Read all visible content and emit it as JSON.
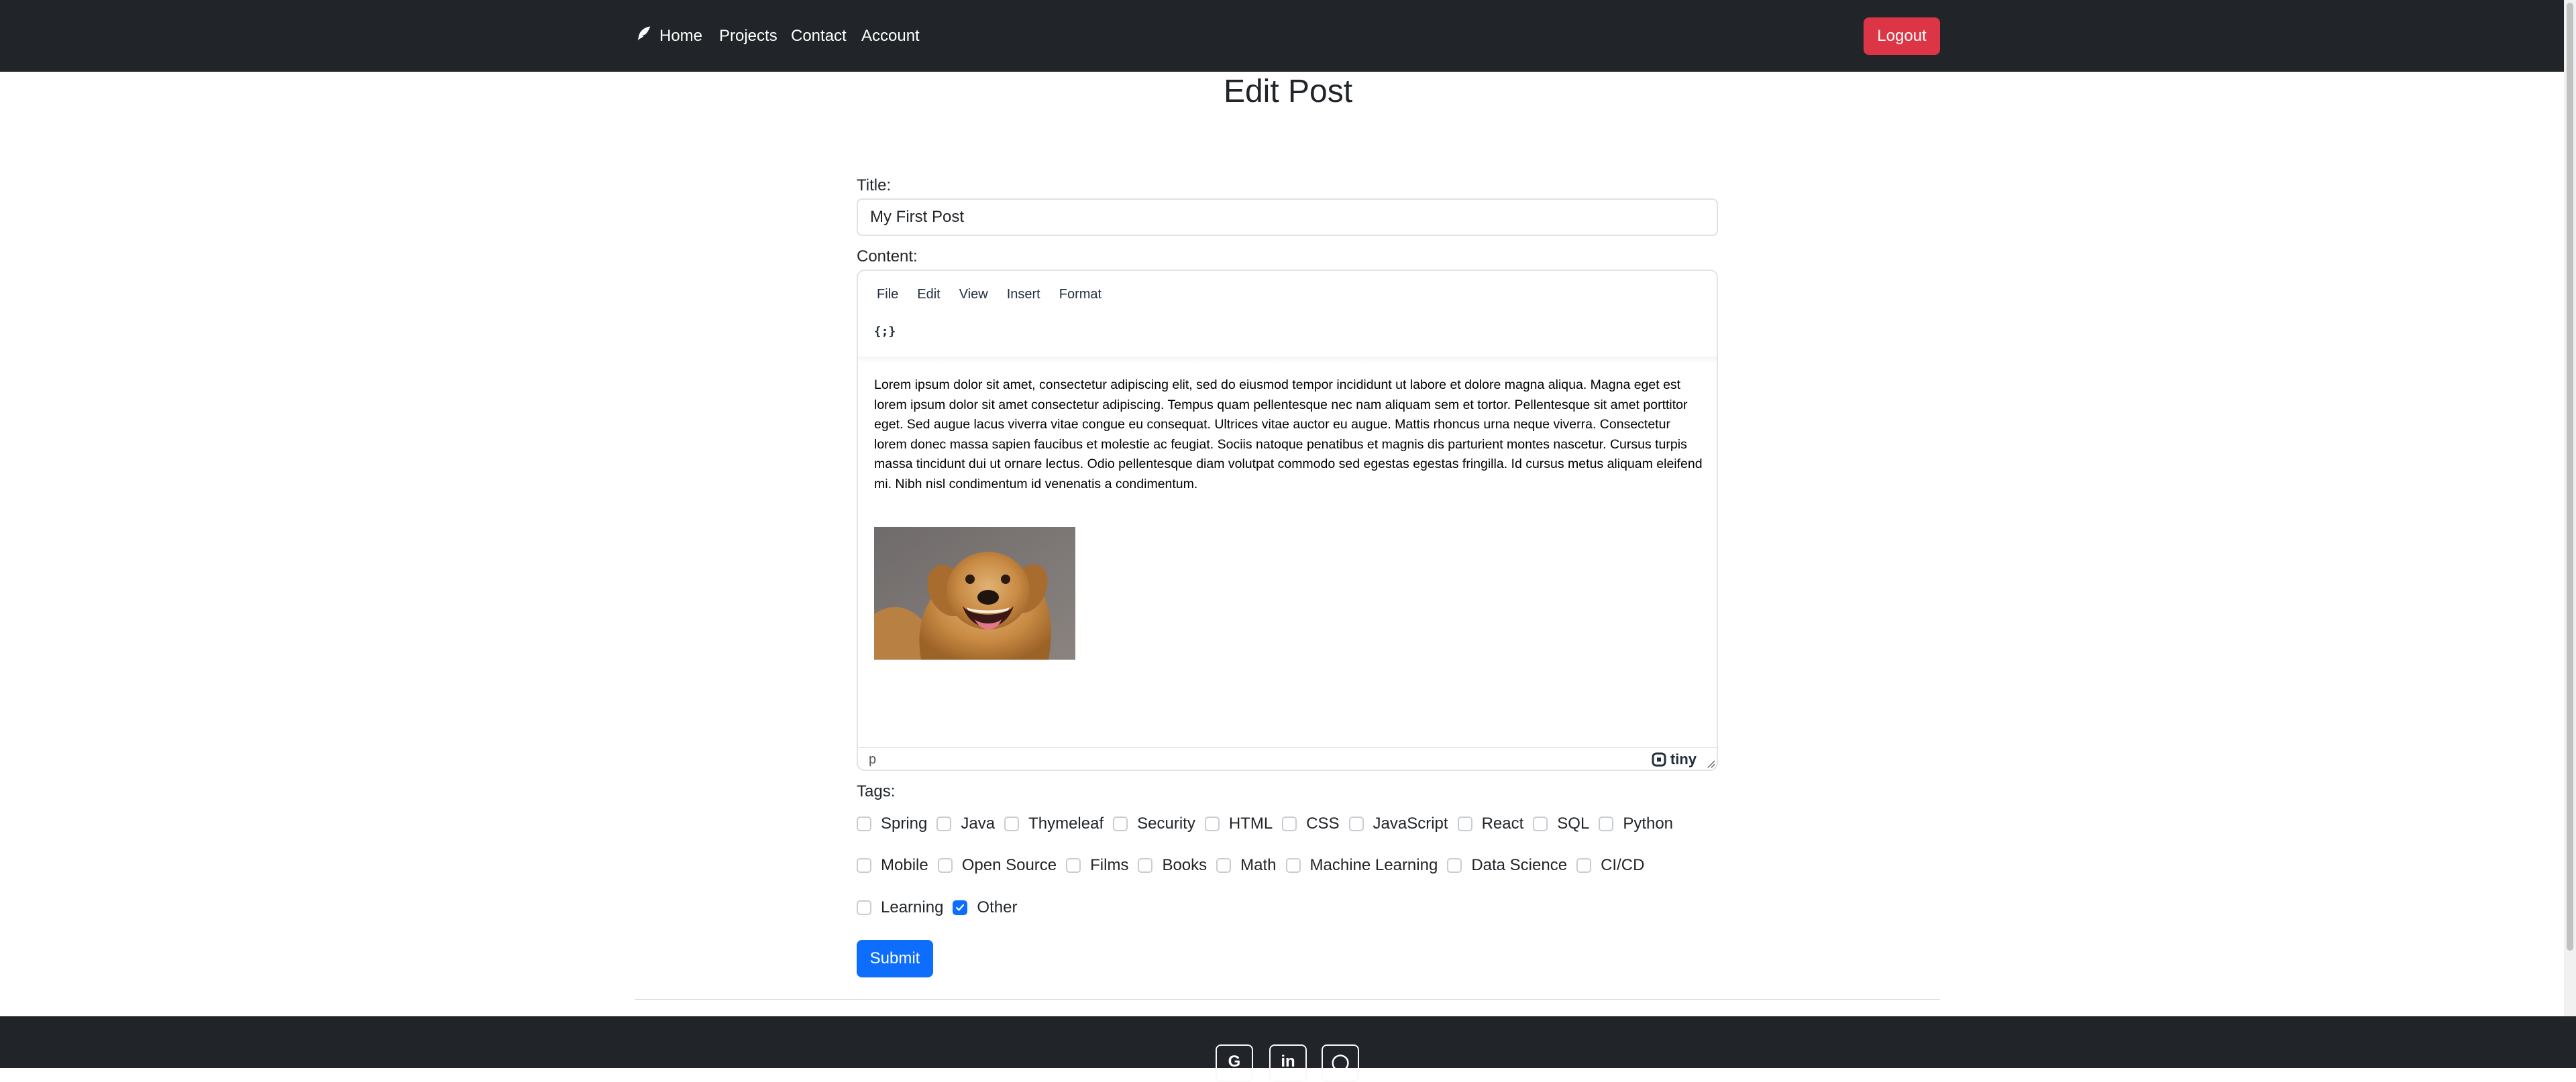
{
  "nav": {
    "home": "Home",
    "projects": "Projects",
    "contact": "Contact",
    "account": "Account",
    "logout": "Logout"
  },
  "page": {
    "title": "Edit Post"
  },
  "form": {
    "title_label": "Title:",
    "title_value": "My First Post",
    "content_label": "Content:",
    "tags_label": "Tags:",
    "submit": "Submit"
  },
  "editor": {
    "menu": [
      "File",
      "Edit",
      "View",
      "Insert",
      "Format"
    ],
    "code_button": "{;}",
    "paragraph": "Lorem ipsum dolor sit amet, consectetur adipiscing elit, sed do eiusmod tempor incididunt ut labore et dolore magna aliqua. Magna eget est lorem ipsum dolor sit amet consectetur adipiscing. Tempus quam pellentesque nec nam aliquam sem et tortor. Pellentesque sit amet porttitor eget. Sed augue lacus viverra vitae congue eu consequat. Ultrices vitae auctor eu augue. Mattis rhoncus urna neque viverra. Consectetur lorem donec massa sapien faucibus et molestie ac feugiat. Sociis natoque penatibus et magnis dis parturient montes nascetur. Cursus turpis massa tincidunt dui ut ornare lectus. Odio pellentesque diam volutpat commodo sed egestas egestas fringilla. Id cursus metus aliquam eleifend mi. Nibh nisl condimentum id venenatis a condimentum.",
    "status_path": "p",
    "brand": "tiny"
  },
  "tags": {
    "row1": [
      {
        "label": "Spring",
        "checked": false
      },
      {
        "label": "Java",
        "checked": false
      },
      {
        "label": "Thymeleaf",
        "checked": false
      },
      {
        "label": "Security",
        "checked": false
      },
      {
        "label": "HTML",
        "checked": false
      },
      {
        "label": "CSS",
        "checked": false
      },
      {
        "label": "JavaScript",
        "checked": false
      },
      {
        "label": "React",
        "checked": false
      },
      {
        "label": "SQL",
        "checked": false
      },
      {
        "label": "Python",
        "checked": false
      }
    ],
    "row2": [
      {
        "label": "Mobile",
        "checked": false
      },
      {
        "label": "Open Source",
        "checked": false
      },
      {
        "label": "Films",
        "checked": false
      },
      {
        "label": "Books",
        "checked": false
      },
      {
        "label": "Math",
        "checked": false
      },
      {
        "label": "Machine Learning",
        "checked": false
      },
      {
        "label": "Data Science",
        "checked": false
      },
      {
        "label": "CI/CD",
        "checked": false
      }
    ],
    "row3": [
      {
        "label": "Learning",
        "checked": false
      },
      {
        "label": "Other",
        "checked": true
      }
    ]
  },
  "footer": {
    "social": [
      {
        "icon": "google-icon",
        "glyph": "G"
      },
      {
        "icon": "linkedin-icon",
        "glyph": "in"
      },
      {
        "icon": "github-icon",
        "glyph": "◯"
      }
    ]
  },
  "colors": {
    "navbar": "#212529",
    "logout": "#dc3545",
    "primary": "#0d6efd"
  }
}
